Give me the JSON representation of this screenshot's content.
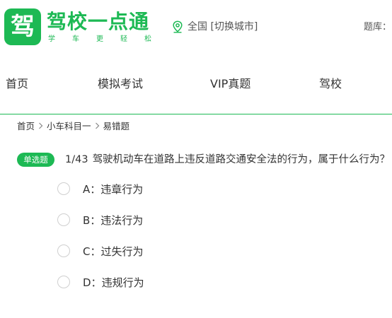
{
  "header": {
    "logo_glyph": "驾",
    "brand": "驾校一点通",
    "slogan": [
      "学",
      "车",
      "更",
      "轻",
      "松"
    ],
    "city": "全国 [切换城市]",
    "qbank_label": "题库："
  },
  "nav": {
    "items": [
      "首页",
      "模拟考试",
      "VIP真题",
      "驾校"
    ]
  },
  "breadcrumb": {
    "items": [
      "首页",
      "小车科目一",
      "易错题"
    ]
  },
  "question": {
    "type_badge": "单选题",
    "number": "1/43",
    "text": "驾驶机动车在道路上违反道路交通安全法的行为，属于什么行为？",
    "options": [
      {
        "letter": "A：",
        "text": "违章行为"
      },
      {
        "letter": "B：",
        "text": "违法行为"
      },
      {
        "letter": "C：",
        "text": "过失行为"
      },
      {
        "letter": "D：",
        "text": "违规行为"
      }
    ]
  },
  "colors": {
    "brand_green": "#1db954",
    "text": "#333333",
    "radio_border": "#cfcfcf"
  }
}
